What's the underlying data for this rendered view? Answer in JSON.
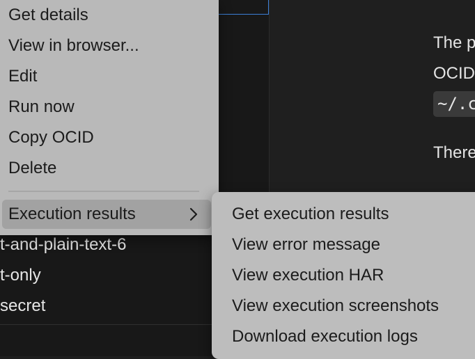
{
  "tree": {
    "items": [
      {
        "label": "t-and-plain-text-6"
      },
      {
        "label": "t-only"
      },
      {
        "label": "secret"
      }
    ]
  },
  "doc": {
    "line1": "The p",
    "line2": "OCID",
    "code": "~/.c",
    "line3": "There"
  },
  "context_menu": {
    "items": [
      {
        "label": "Get details"
      },
      {
        "label": "View in browser..."
      },
      {
        "label": "Edit"
      },
      {
        "label": "Run now"
      },
      {
        "label": "Copy OCID"
      },
      {
        "label": "Delete"
      }
    ],
    "submenu_label": "Execution results"
  },
  "submenu": {
    "items": [
      {
        "label": "Get execution results"
      },
      {
        "label": "View error message"
      },
      {
        "label": "View execution HAR"
      },
      {
        "label": "View execution screenshots"
      },
      {
        "label": "Download execution logs"
      }
    ]
  },
  "icons": {
    "submenu_arrow": "chevron-right-icon"
  },
  "colors": {
    "menu_background": "#b9b9b9",
    "menu_highlight": "#a2a2a2",
    "selection_outline": "#3c7fd6"
  }
}
